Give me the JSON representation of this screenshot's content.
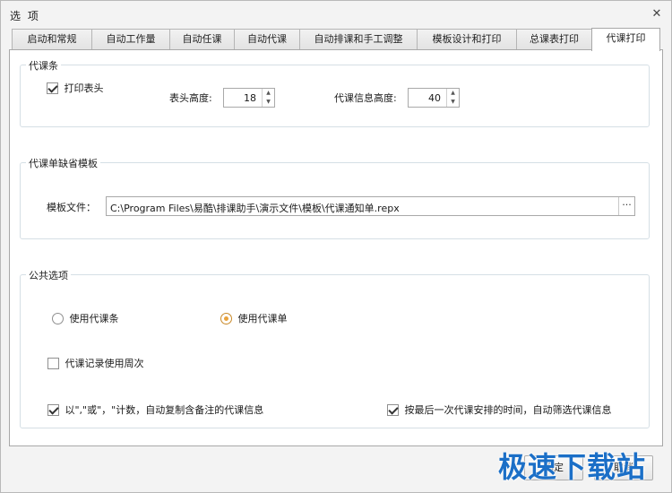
{
  "window": {
    "title": "选 项",
    "close": "✕"
  },
  "tabs": [
    {
      "label": "启动和常规"
    },
    {
      "label": "自动工作量"
    },
    {
      "label": "自动任课"
    },
    {
      "label": "自动代课"
    },
    {
      "label": "自动排课和手工调整"
    },
    {
      "label": "模板设计和打印"
    },
    {
      "label": "总课表打印"
    },
    {
      "label": "代课打印"
    }
  ],
  "group_daike_tiao": {
    "title": "代课条",
    "print_header_label": "打印表头",
    "print_header_checked": true,
    "header_height_label": "表头高度:",
    "header_height_value": "18",
    "info_height_label": "代课信息高度:",
    "info_height_value": "40"
  },
  "group_template": {
    "title": "代课单缺省模板",
    "file_label": "模板文件：",
    "file_path": "C:\\Program Files\\易酷\\排课助手\\演示文件\\模板\\代课通知单.repx",
    "browse": "···"
  },
  "group_common": {
    "title": "公共选项",
    "radio_use_tiao": "使用代课条",
    "radio_use_dan": "使用代课单",
    "selected": "使用代课单",
    "use_week_label": "代课记录使用周次",
    "use_week_checked": false,
    "copy_note_label": "以\",\"或\"，\"计数，自动复制含备注的代课信息",
    "copy_note_checked": true,
    "filter_last_label": "按最后一次代课安排的时间，自动筛选代课信息",
    "filter_last_checked": true
  },
  "buttons": {
    "ok": "确定",
    "cancel": "取消"
  },
  "watermark": "极速下载站"
}
